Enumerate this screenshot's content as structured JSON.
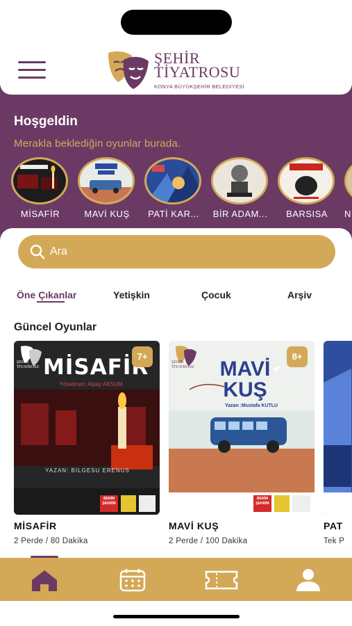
{
  "header": {
    "logo_title_line1": "ŞEHİR",
    "logo_title_line2": "TİYATROSU",
    "logo_subtitle": "KONYA BÜYÜKŞEHİR BELEDİYESİ"
  },
  "welcome": {
    "title": "Hoşgeldin",
    "subtitle": "Merakla beklediğin oyunlar burada."
  },
  "stories": [
    {
      "label": "MİSAFİR"
    },
    {
      "label": "MAVİ KUŞ"
    },
    {
      "label": "PATİ KAR..."
    },
    {
      "label": "BİR ADAM..."
    },
    {
      "label": "BARSISA"
    },
    {
      "label": "N"
    }
  ],
  "search": {
    "placeholder": "Ara"
  },
  "tabs": [
    {
      "label": "Öne Çıkanlar",
      "active": true
    },
    {
      "label": "Yetişkin"
    },
    {
      "label": "Çocuk"
    },
    {
      "label": "Arşiv"
    }
  ],
  "section": {
    "title": "Güncel Oyunlar"
  },
  "cards": [
    {
      "title": "MİSAFİR",
      "meta": "2 Perde / 80 Dakika",
      "age": "7+",
      "poster_heading": "MİSAFİR",
      "poster_director": "Yönetmen: Alpay AKSUM",
      "poster_writer": "YAZAN: BİLGESU ERENUS",
      "poster_logo_top": "ŞEHİR",
      "poster_logo_bottom": "TİYATROSU",
      "poster_tag1": "BENİM",
      "poster_tag2": "ŞEHRİM"
    },
    {
      "title": "MAVİ KUŞ",
      "meta": "2 Perde / 100 Dakika",
      "age": "8+",
      "poster_heading1": "MAVİ",
      "poster_heading2": "KUŞ",
      "poster_writer": "Yazan :Mustafa KUTLU",
      "poster_logo_top": "ŞEHİR",
      "poster_logo_bottom": "TİYATROSU",
      "poster_tag1": "BENİM",
      "poster_tag2": "ŞEHRİM"
    },
    {
      "title": "PAT",
      "meta": "Tek P"
    }
  ],
  "colors": {
    "brand_purple": "#6b3a64",
    "brand_gold": "#d3a957"
  },
  "bottom_nav": [
    {
      "icon": "home-icon",
      "active": true
    },
    {
      "icon": "calendar-icon"
    },
    {
      "icon": "ticket-icon"
    },
    {
      "icon": "profile-icon"
    }
  ]
}
